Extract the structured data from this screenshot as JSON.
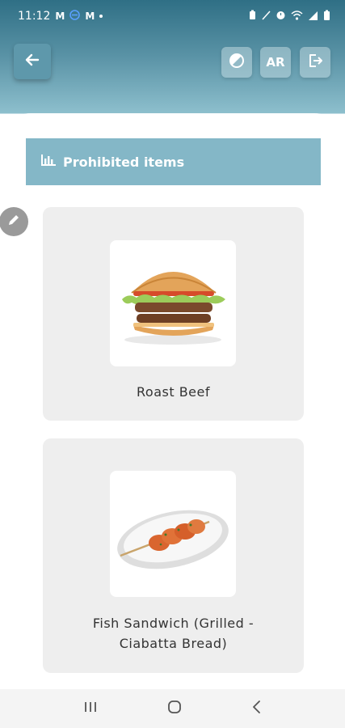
{
  "status_bar": {
    "time": "11:12",
    "notification_icons": [
      "gmail-icon",
      "vpn-icon",
      "gmail-icon"
    ],
    "system_icons": [
      "battery-saver-icon",
      "mute-icon",
      "alarm-icon",
      "wifi-icon",
      "signal-icon",
      "battery-icon"
    ]
  },
  "toolbar": {
    "back_icon": "arrow-left-icon",
    "theme_icon": "contrast-icon",
    "language_label": "AR",
    "logout_icon": "logout-icon"
  },
  "section": {
    "title": "Prohibited items",
    "icon": "bar-chart-icon",
    "color": "#84b7c7"
  },
  "items": [
    {
      "name": "Roast Beef",
      "image": "burger-image"
    },
    {
      "name": "Fish Sandwich (Grilled - Ciabatta Bread)",
      "image": "shrimp-skewer-image"
    }
  ],
  "nav": {
    "recents_icon": "recents-icon",
    "home_icon": "home-icon",
    "back_icon": "nav-back-icon"
  }
}
